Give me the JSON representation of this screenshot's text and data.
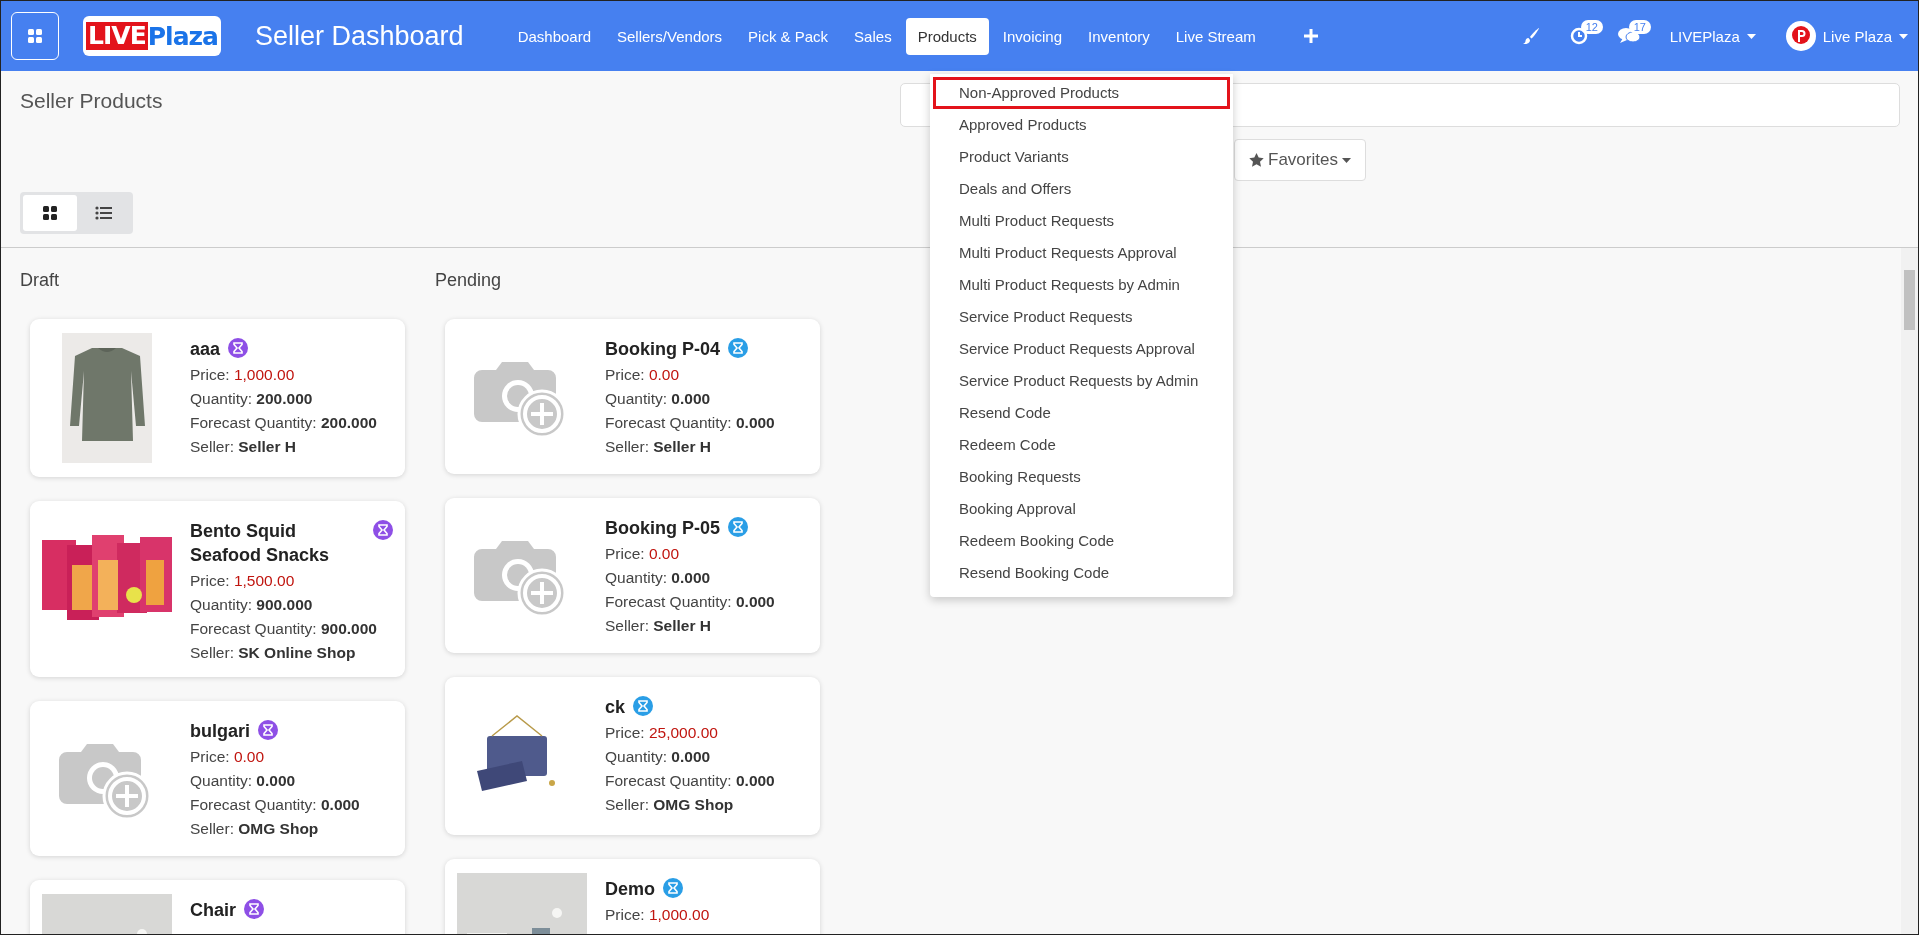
{
  "navbar": {
    "logo": {
      "part_1": "LIVE",
      "part_2": "Plaza"
    },
    "title": "Seller Dashboard",
    "tabs": [
      {
        "label": "Dashboard",
        "selected": false
      },
      {
        "label": "Sellers/Vendors",
        "selected": false
      },
      {
        "label": "Pick & Pack",
        "selected": false
      },
      {
        "label": "Sales",
        "selected": false
      },
      {
        "label": "Products",
        "selected": true
      },
      {
        "label": "Invoicing",
        "selected": false
      },
      {
        "label": "Inventory",
        "selected": false
      },
      {
        "label": "Live Stream",
        "selected": false
      }
    ],
    "notifications": [
      {
        "kind": "activity",
        "count": "12"
      },
      {
        "kind": "chat",
        "count": "17"
      }
    ],
    "company": "LIVEPlaza",
    "user": "Live Plaza"
  },
  "products_menu": [
    {
      "label": "Non-Approved Products",
      "selected": true
    },
    {
      "label": "Approved Products",
      "selected": false
    },
    {
      "label": "Product Variants",
      "selected": false
    },
    {
      "label": "Deals and Offers",
      "selected": false
    },
    {
      "label": "Multi Product Requests",
      "selected": false
    },
    {
      "label": "Multi Product Requests Approval",
      "selected": false
    },
    {
      "label": "Multi Product Requests by Admin",
      "selected": false
    },
    {
      "label": "Service Product Requests",
      "selected": false
    },
    {
      "label": "Service Product Requests Approval",
      "selected": false
    },
    {
      "label": "Service Product Requests by Admin",
      "selected": false
    },
    {
      "label": "Resend Code",
      "selected": false
    },
    {
      "label": "Redeem Code",
      "selected": false
    },
    {
      "label": "Booking Requests",
      "selected": false
    },
    {
      "label": "Booking Approval",
      "selected": false
    },
    {
      "label": "Redeem Booking Code",
      "selected": false
    },
    {
      "label": "Resend Booking Code",
      "selected": false
    }
  ],
  "page": {
    "title": "Seller Products",
    "favorites": "Favorites",
    "views": [
      {
        "kind": "kanban",
        "selected": true
      },
      {
        "kind": "list",
        "selected": false
      }
    ]
  },
  "columns": [
    {
      "title": "Draft",
      "color": "#8e4fe6",
      "cards": [
        {
          "name": "aaa",
          "kind": "picture",
          "fields": [
            {
              "label": "Price:",
              "value": "1,000.00",
              "kind": "price"
            },
            {
              "label": "Quantity:",
              "value": "200.000",
              "kind": "plain"
            },
            {
              "label": "Forecast Quantity:",
              "value": "200.000",
              "kind": "plain"
            },
            {
              "label": "Seller:",
              "value": "Seller H",
              "kind": "plain"
            }
          ]
        },
        {
          "name": "Bento Squid Seafood Snacks",
          "kind": "picture",
          "fields": [
            {
              "label": "Price:",
              "value": "1,500.00",
              "kind": "price"
            },
            {
              "label": "Quantity:",
              "value": "900.000",
              "kind": "plain"
            },
            {
              "label": "Forecast Quantity:",
              "value": "900.000",
              "kind": "plain"
            },
            {
              "label": "Seller:",
              "value": "SK Online Shop",
              "kind": "plain"
            }
          ]
        },
        {
          "name": "bulgari",
          "kind": "placeholder",
          "fields": [
            {
              "label": "Price:",
              "value": "0.00",
              "kind": "price"
            },
            {
              "label": "Quantity:",
              "value": "0.000",
              "kind": "plain"
            },
            {
              "label": "Forecast Quantity:",
              "value": "0.000",
              "kind": "plain"
            },
            {
              "label": "Seller:",
              "value": "OMG Shop",
              "kind": "plain"
            }
          ]
        },
        {
          "name": "Chair",
          "kind": "picture"
        }
      ]
    },
    {
      "title": "Pending",
      "color": "#2a9ee6",
      "cards": [
        {
          "name": "Booking P-04",
          "kind": "placeholder",
          "fields": [
            {
              "label": "Price:",
              "value": "0.00",
              "kind": "price"
            },
            {
              "label": "Quantity:",
              "value": "0.000",
              "kind": "plain"
            },
            {
              "label": "Forecast Quantity:",
              "value": "0.000",
              "kind": "plain"
            },
            {
              "label": "Seller:",
              "value": "Seller H",
              "kind": "plain"
            }
          ]
        },
        {
          "name": "Booking P-05",
          "kind": "placeholder",
          "fields": [
            {
              "label": "Price:",
              "value": "0.00",
              "kind": "price"
            },
            {
              "label": "Quantity:",
              "value": "0.000",
              "kind": "plain"
            },
            {
              "label": "Forecast Quantity:",
              "value": "0.000",
              "kind": "plain"
            },
            {
              "label": "Seller:",
              "value": "Seller H",
              "kind": "plain"
            }
          ]
        },
        {
          "name": "ck",
          "kind": "picture",
          "fields": [
            {
              "label": "Price:",
              "value": "25,000.00",
              "kind": "price"
            },
            {
              "label": "Quantity:",
              "value": "0.000",
              "kind": "plain"
            },
            {
              "label": "Forecast Quantity:",
              "value": "0.000",
              "kind": "plain"
            },
            {
              "label": "Seller:",
              "value": "OMG Shop",
              "kind": "plain"
            }
          ]
        },
        {
          "name": "Demo",
          "kind": "picture",
          "fields": [
            {
              "label": "Price:",
              "value": "1,000.00",
              "kind": "price"
            }
          ]
        }
      ]
    }
  ]
}
